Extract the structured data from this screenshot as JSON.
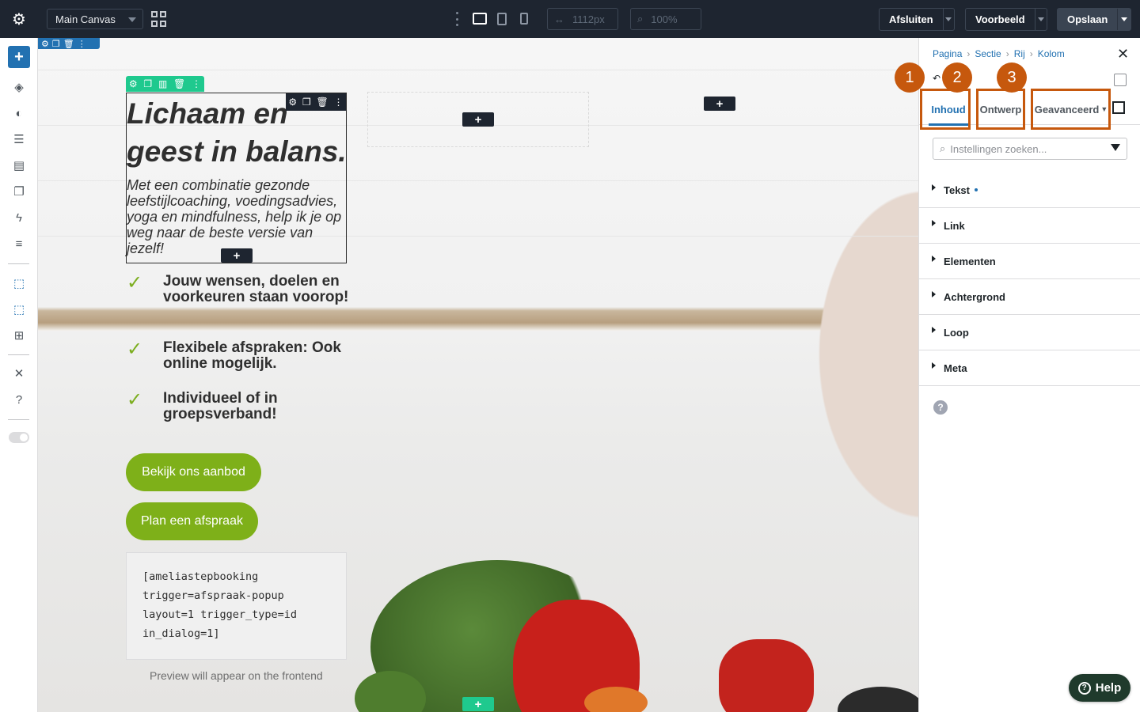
{
  "topbar": {
    "canvas_select": "Main Canvas",
    "width_value": "1112px",
    "zoom_value": "100%",
    "close_label": "Afsluiten",
    "preview_label": "Voorbeeld",
    "save_label": "Opslaan"
  },
  "canvas": {
    "heading": "Lichaam en geest in balans.",
    "intro": "Met een combinatie gezonde leefstijlcoaching, voedingsadvies, yoga en mindfulness, help ik je op weg naar de beste versie van jezelf!",
    "checklist": [
      "Jouw wensen, doelen en voorkeuren staan voorop!",
      "Flexibele afspraken: Ook online mogelijk.",
      "Individueel of in groepsverband!"
    ],
    "button_offer": "Bekijk ons aanbod",
    "button_appointment": "Plan een afspraak",
    "shortcode": "[ameliastepbooking trigger=afspraak-popup layout=1 trigger_type=id in_dialog=1]",
    "preview_note": "Preview will appear on the frontend",
    "plus": "+",
    "check": "✓"
  },
  "panel": {
    "breadcrumb": [
      "Pagina",
      "Sectie",
      "Rij",
      "Kolom"
    ],
    "tabs": [
      "Inhoud",
      "Ontwerp",
      "Geavanceerd"
    ],
    "search_placeholder": "Instellingen zoeken...",
    "sections": [
      "Tekst",
      "Link",
      "Elementen",
      "Achtergrond",
      "Loop",
      "Meta"
    ],
    "annotations": [
      "1",
      "2",
      "3"
    ]
  },
  "help_button": "Help",
  "colors": {
    "accent": "#2271b1",
    "topbar": "#1e2530",
    "green_button": "#7eb019",
    "annotation": "#c6580d",
    "column_tools": "#1fc98e"
  }
}
